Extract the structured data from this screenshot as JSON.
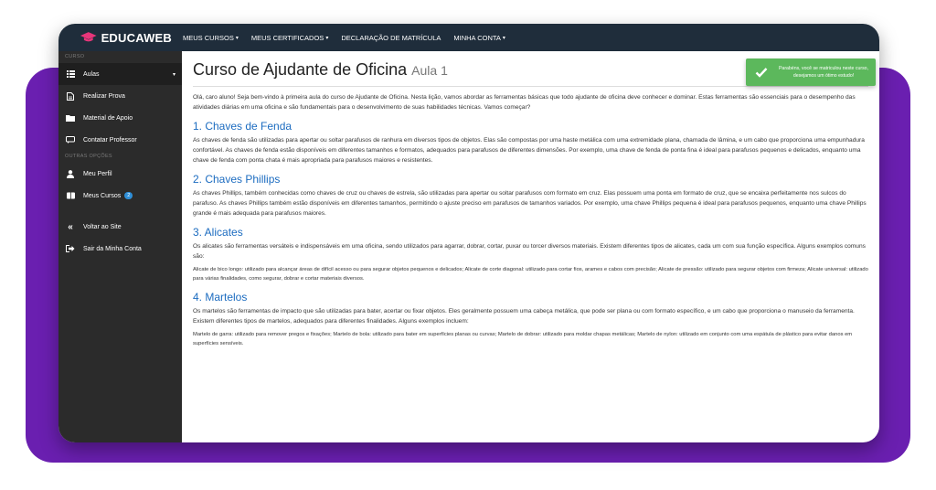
{
  "brand": {
    "name": "EDUCAWEB"
  },
  "nav": [
    {
      "label": "MEUS CURSOS",
      "dropdown": true
    },
    {
      "label": "MEUS CERTIFICADOS",
      "dropdown": true
    },
    {
      "label": "DECLARAÇÃO DE MATRÍCULA",
      "dropdown": false
    },
    {
      "label": "MINHA CONTA",
      "dropdown": true
    }
  ],
  "sidebar": {
    "section_curso": "CURSO",
    "section_outras": "OUTRAS OPÇÕES",
    "items": [
      {
        "label": "Aulas",
        "icon": "list-icon"
      },
      {
        "label": "Realizar Prova",
        "icon": "document-icon"
      },
      {
        "label": "Material de Apoio",
        "icon": "folder-icon"
      },
      {
        "label": "Contatar Professor",
        "icon": "chat-icon"
      },
      {
        "label": "Meu Perfil",
        "icon": "user-icon"
      },
      {
        "label": "Meus Cursos",
        "icon": "book-icon",
        "badge": "2"
      },
      {
        "label": "Voltar ao Site",
        "icon": "double-chevron-left-icon"
      },
      {
        "label": "Sair da Minha Conta",
        "icon": "sign-out-icon"
      }
    ]
  },
  "page": {
    "title": "Curso de Ajudante de Oficina",
    "subtitle": "Aula 1",
    "intro": "Olá, caro aluno! Seja bem-vindo à primeira aula do curso de Ajudante de Oficina. Nesta lição, vamos abordar as ferramentas básicas que todo ajudante de oficina deve conhecer e dominar. Estas ferramentas são essenciais para o desempenho das atividades diárias em uma oficina e são fundamentais para o desenvolvimento de suas habilidades técnicas. Vamos começar?",
    "sections": [
      {
        "heading": "1. Chaves de Fenda",
        "text": "As chaves de fenda são utilizadas para apertar ou soltar parafusos de ranhura em diversos tipos de objetos. Elas são compostas por uma haste metálica com uma extremidade plana, chamada de lâmina, e um cabo que proporciona uma empunhadura confortável. As chaves de fenda estão disponíveis em diferentes tamanhos e formatos, adequados para parafusos de diferentes dimensões. Por exemplo, uma chave de fenda de ponta fina é ideal para parafusos pequenos e delicados, enquanto uma chave de fenda com ponta chata é mais apropriada para parafusos maiores e resistentes.",
        "detail": ""
      },
      {
        "heading": "2. Chaves Phillips",
        "text": "As chaves Phillips, também conhecidas como chaves de cruz ou chaves de estrela, são utilizadas para apertar ou soltar parafusos com formato em cruz. Elas possuem uma ponta em formato de cruz, que se encaixa perfeitamente nos sulcos do parafuso. As chaves Phillips também estão disponíveis em diferentes tamanhos, permitindo o ajuste preciso em parafusos de tamanhos variados. Por exemplo, uma chave Phillips pequena é ideal para parafusos pequenos, enquanto uma chave Phillips grande é mais adequada para parafusos maiores.",
        "detail": ""
      },
      {
        "heading": "3. Alicates",
        "text": "Os alicates são ferramentas versáteis e indispensáveis em uma oficina, sendo utilizados para agarrar, dobrar, cortar, puxar ou torcer diversos materiais. Existem diferentes tipos de alicates, cada um com sua função específica. Alguns exemplos comuns são:",
        "detail": "Alicate de bico longo: utilizado para alcançar áreas de difícil acesso ou para segurar objetos pequenos e delicados; Alicate de corte diagonal: utilizado para cortar fios, arames e cabos com precisão; Alicate de pressão: utilizado para segurar objetos com firmeza; Alicate universal: utilizado para várias finalidades, como segurar, dobrar e cortar materiais diversos."
      },
      {
        "heading": "4. Martelos",
        "text": "Os martelos são ferramentas de impacto que são utilizadas para bater, acertar ou fixar objetos. Eles geralmente possuem uma cabeça metálica, que pode ser plana ou com formato específico, e um cabo que proporciona o manuseio da ferramenta. Existem diferentes tipos de martelos, adequados para diferentes finalidades. Alguns exemplos incluem:",
        "detail": "Martelo de garra: utilizado para remover pregos e fixações; Martelo de bola: utilizado para bater em superfícies planas ou curvas; Martelo de dobrar: utilizado para moldar chapas metálicas; Martelo de nylon: utilizado em conjunto com uma espátula de plástico para evitar danos em superfícies sensíveis."
      }
    ]
  },
  "toast": {
    "message": "Parabéns, você se matriculou neste curso, desejamos um ótimo estudo!",
    "icon": "check-icon"
  },
  "colors": {
    "accent_purple": "#6a1fb0",
    "topbar": "#1f2d3b",
    "sidebar": "#2b2b2b",
    "heading_blue": "#1c6cc0",
    "toast_green": "#5cb85c",
    "logo_pink": "#e8357a"
  }
}
